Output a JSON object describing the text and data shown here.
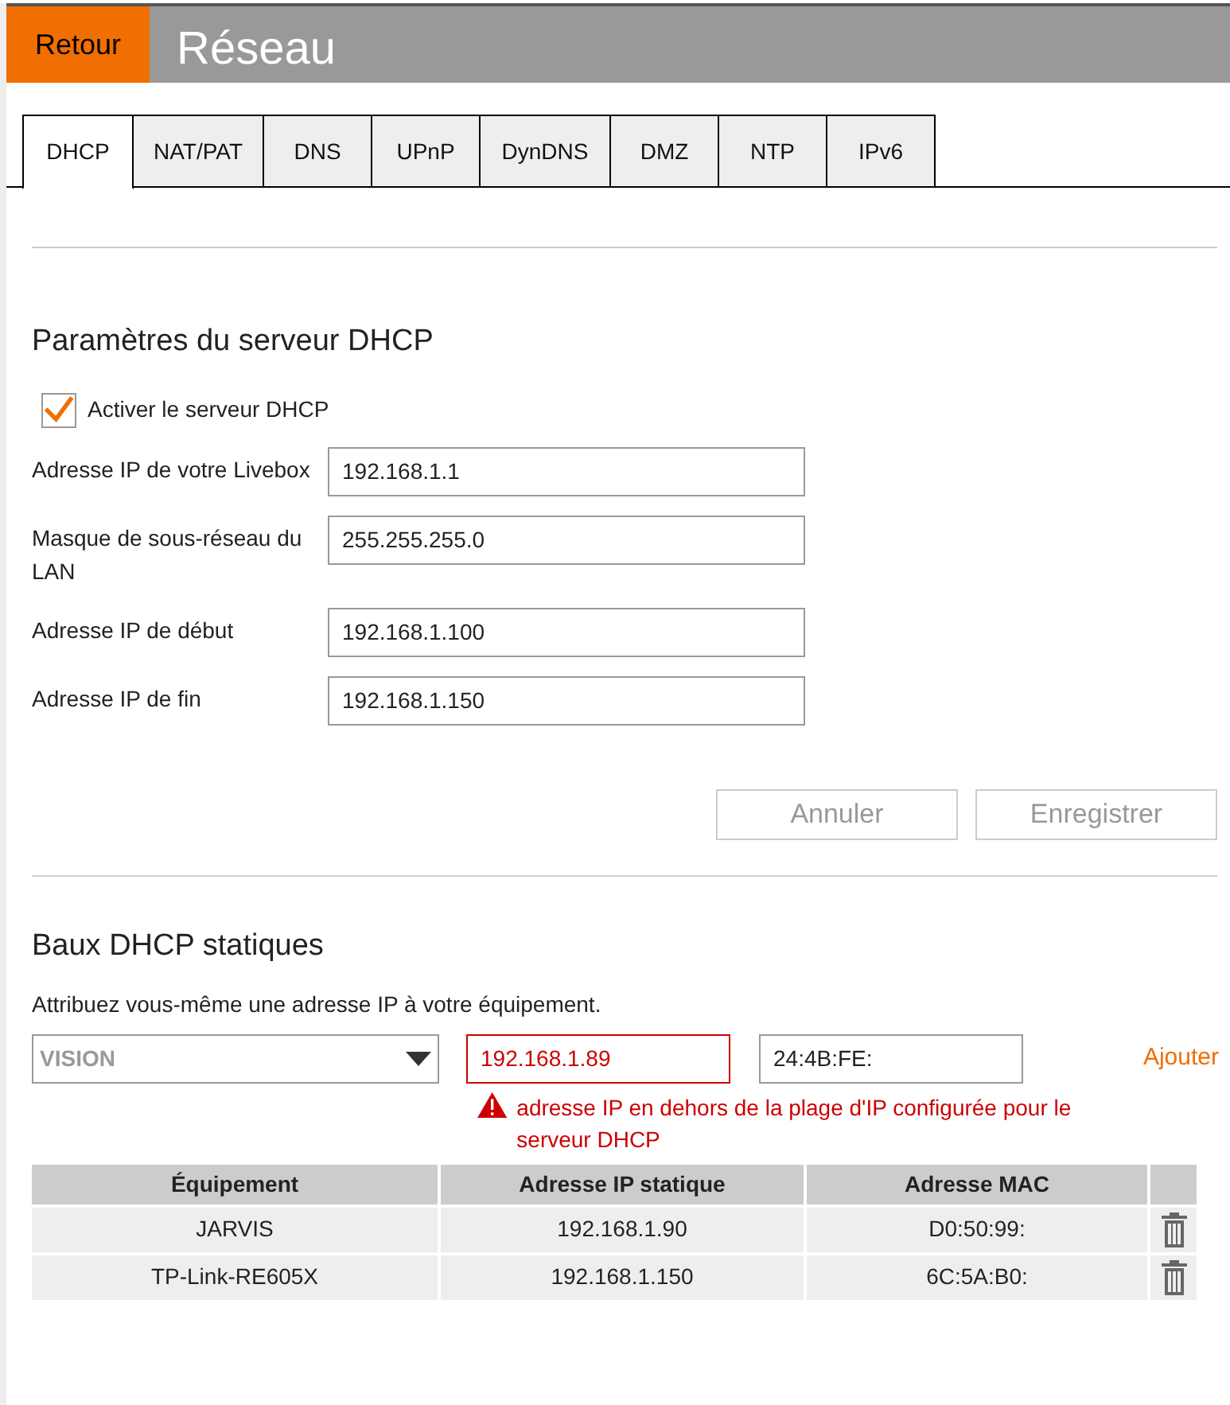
{
  "header": {
    "back_button": "Retour",
    "title": "Réseau"
  },
  "tabs": [
    {
      "label": "DHCP",
      "selected": true
    },
    {
      "label": "NAT/PAT",
      "selected": false
    },
    {
      "label": "DNS",
      "selected": false
    },
    {
      "label": "UPnP",
      "selected": false
    },
    {
      "label": "DynDNS",
      "selected": false
    },
    {
      "label": "DMZ",
      "selected": false
    },
    {
      "label": "NTP",
      "selected": false
    },
    {
      "label": "IPv6",
      "selected": false
    }
  ],
  "dhcp_server": {
    "heading": "Paramètres du serveur DHCP",
    "enable": {
      "label": "Activer le serveur DHCP",
      "checked": true
    },
    "fields": [
      {
        "label": "Adresse IP de votre Livebox",
        "value": "192.168.1.1"
      },
      {
        "label": "Masque de sous-réseau du LAN",
        "value": "255.255.255.0"
      },
      {
        "label": "Adresse IP de début",
        "value": "192.168.1.100"
      },
      {
        "label": "Adresse IP de fin",
        "value": "192.168.1.150"
      }
    ],
    "buttons": [
      {
        "label": "Annuler",
        "disabled": true
      },
      {
        "label": "Enregistrer",
        "disabled": true
      }
    ]
  },
  "static_leases": {
    "heading": "Baux DHCP statiques",
    "description": "Attribuez vous-même une adresse IP à votre équipement.",
    "device_select": {
      "value": "VISION"
    },
    "ip_field": {
      "value": "192.168.1.89",
      "invalid": true
    },
    "mac_field": {
      "value": "24:4B:FE:"
    },
    "add_link": "Ajouter",
    "error": "adresse IP en dehors de la plage d'IP configurée pour le serveur DHCP",
    "table": {
      "columns": [
        "Équipement",
        "Adresse IP statique",
        "Adresse MAC"
      ],
      "rows": [
        {
          "device": "JARVIS",
          "ip": "192.168.1.90",
          "mac": "D0:50:99:"
        },
        {
          "device": "TP-Link-RE605X",
          "ip": "192.168.1.150",
          "mac": "6C:5A:B0:"
        }
      ]
    }
  }
}
